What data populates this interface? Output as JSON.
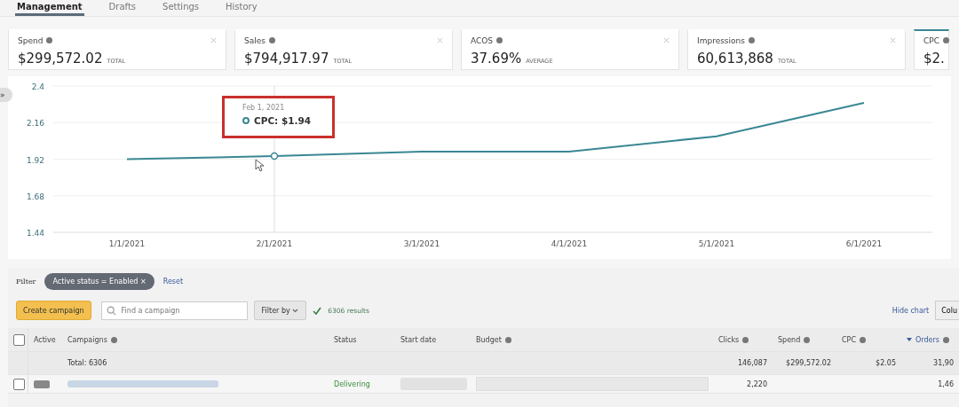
{
  "tabs": [
    {
      "label": "Management",
      "selected": true
    },
    {
      "label": "Drafts",
      "selected": false
    },
    {
      "label": "Settings",
      "selected": false
    },
    {
      "label": "History",
      "selected": false
    }
  ],
  "metrics": [
    {
      "label": "Spend",
      "value": "$299,572.02",
      "unit": "TOTAL",
      "selected": false
    },
    {
      "label": "Sales",
      "value": "$794,917.97",
      "unit": "TOTAL",
      "selected": false
    },
    {
      "label": "ACOS",
      "value": "37.69%",
      "unit": "AVERAGE",
      "selected": false
    },
    {
      "label": "Impressions",
      "value": "60,613,868",
      "unit": "TOTAL",
      "selected": false
    },
    {
      "label": "CPC",
      "value": "$2.",
      "selected": true
    }
  ],
  "chart": {
    "expand_icon": "»",
    "tooltip": {
      "date": "Feb 1, 2021",
      "separator": ":",
      "value": "$1.94"
    },
    "chart_data": {
      "type": "line",
      "categories": [
        "1/1/2021",
        "2/1/2021",
        "3/1/2021",
        "4/1/2021",
        "5/1/2021",
        "6/1/2021"
      ],
      "yticks": [
        1.44,
        1.68,
        1.92,
        2.16,
        2.4
      ],
      "ylim": [
        1.44,
        2.4
      ],
      "grid": true,
      "ref_lines": [
        {
          "axis": "x",
          "value": "2/1/2021",
          "color": "#dddddd"
        }
      ],
      "series": [
        {
          "name": "CPC",
          "color": "#3a8794",
          "values": [
            1.92,
            1.94,
            1.97,
            1.97,
            2.07,
            2.29
          ]
        }
      ]
    }
  },
  "filter": {
    "label": "Filter",
    "chip": "Active status = Enabled",
    "chip_close": "×",
    "reset": "Reset"
  },
  "toolbar": {
    "create": "Create campaign",
    "search_placeholder": "Find a campaign",
    "filter_by": "Filter by",
    "results": "6306 results",
    "hide_chart": "Hide chart",
    "columns": "Colu"
  },
  "table": {
    "select_all": {
      "checked": false
    },
    "columns": [
      {
        "label": "Active",
        "info": false,
        "sorted": false
      },
      {
        "label": "Campaigns",
        "info": true,
        "sorted": false
      },
      {
        "label": "Status",
        "info": false,
        "sorted": false
      },
      {
        "label": "Start date",
        "info": false,
        "sorted": false
      },
      {
        "label": "Budget",
        "info": true,
        "sorted": false
      },
      {
        "label": "Clicks",
        "info": true,
        "sorted": false
      },
      {
        "label": "Spend",
        "info": true,
        "sorted": false
      },
      {
        "label": "CPC",
        "info": true,
        "sorted": false
      },
      {
        "label": "Orders",
        "info": true,
        "sorted": true
      }
    ],
    "totals": {
      "label": "Total: 6306",
      "clicks": "146,087",
      "spend": "$299,572.02",
      "cpc": "$2.05",
      "orders": "31,90"
    },
    "rows": [
      {
        "checked": false,
        "on": true,
        "status": "Delivering",
        "clicks": "2,220",
        "orders": "1,46"
      }
    ]
  }
}
